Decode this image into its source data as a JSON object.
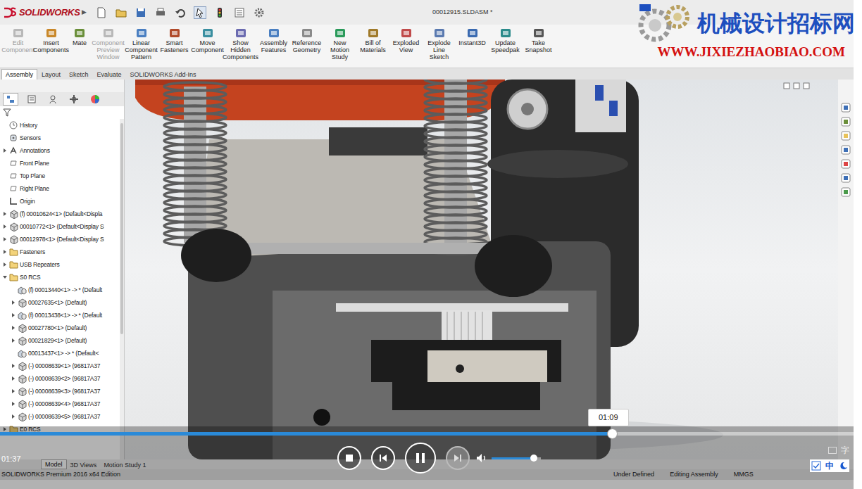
{
  "window": {
    "title": "00012915.SLDASM *",
    "brand": "SOLIDWORKS",
    "expand": "▶"
  },
  "watermark": {
    "name": "机械设计招标网",
    "url": "WWW.JIXIEZHAOBIAO.COM"
  },
  "ribbon": [
    {
      "label": "Edit Component",
      "disabled": true
    },
    {
      "label": "Insert Components",
      "disabled": false
    },
    {
      "label": "Mate",
      "disabled": false
    },
    {
      "label": "Component Preview Window",
      "disabled": true
    },
    {
      "label": "Linear Component Pattern",
      "disabled": false
    },
    {
      "label": "Smart Fasteners",
      "disabled": false
    },
    {
      "label": "Move Component",
      "disabled": false
    },
    {
      "label": "Show Hidden Components",
      "disabled": false
    },
    {
      "label": "Assembly Features",
      "disabled": false
    },
    {
      "label": "Reference Geometry",
      "disabled": false
    },
    {
      "label": "New Motion Study",
      "disabled": false
    },
    {
      "label": "Bill of Materials",
      "disabled": false
    },
    {
      "label": "Exploded View",
      "disabled": false
    },
    {
      "label": "Explode Line Sketch",
      "disabled": false
    },
    {
      "label": "Instant3D",
      "disabled": false
    },
    {
      "label": "Update Speedpak",
      "disabled": false
    },
    {
      "label": "Take Snapshot",
      "disabled": false
    }
  ],
  "tabs": [
    {
      "label": "Assembly",
      "selected": true
    },
    {
      "label": "Layout",
      "selected": false
    },
    {
      "label": "Sketch",
      "selected": false
    },
    {
      "label": "Evaluate",
      "selected": false
    },
    {
      "label": "SOLIDWORKS Add-Ins",
      "selected": false
    }
  ],
  "tree": [
    {
      "label": "History",
      "kind": "history",
      "level": 0,
      "has_children": false,
      "expanded": false
    },
    {
      "label": "Sensors",
      "kind": "sensors",
      "level": 0,
      "has_children": false,
      "expanded": false
    },
    {
      "label": "Annotations",
      "kind": "annotations",
      "level": 0,
      "has_children": true,
      "expanded": false
    },
    {
      "label": "Front Plane",
      "kind": "plane",
      "level": 0,
      "has_children": false,
      "expanded": false
    },
    {
      "label": "Top Plane",
      "kind": "plane",
      "level": 0,
      "has_children": false,
      "expanded": false
    },
    {
      "label": "Right Plane",
      "kind": "plane",
      "level": 0,
      "has_children": false,
      "expanded": false
    },
    {
      "label": "Origin",
      "kind": "origin",
      "level": 0,
      "has_children": false,
      "expanded": false
    },
    {
      "label": "(f) 00010624<1> (Default<Displa",
      "kind": "part",
      "level": 0,
      "has_children": true,
      "expanded": false
    },
    {
      "label": "00010772<1> (Default<Display S",
      "kind": "part",
      "level": 0,
      "has_children": true,
      "expanded": false
    },
    {
      "label": "00012978<1> (Default<Display S",
      "kind": "part",
      "level": 0,
      "has_children": true,
      "expanded": false
    },
    {
      "label": "Fasteners",
      "kind": "folder",
      "level": 0,
      "has_children": true,
      "expanded": false
    },
    {
      "label": "USB Repeaters",
      "kind": "folder",
      "level": 0,
      "has_children": true,
      "expanded": false
    },
    {
      "label": "S0 RCS",
      "kind": "folder",
      "level": 0,
      "has_children": true,
      "expanded": true
    },
    {
      "label": "(f) 00013440<1> -> * (Default",
      "kind": "assembly",
      "level": 1,
      "has_children": false,
      "expanded": false
    },
    {
      "label": "00027635<1> (Default)",
      "kind": "part",
      "level": 1,
      "has_children": true,
      "expanded": false
    },
    {
      "label": "(f) 00013438<1> -> * (Default",
      "kind": "assembly",
      "level": 1,
      "has_children": true,
      "expanded": false
    },
    {
      "label": "00027780<1> (Default)",
      "kind": "part",
      "level": 1,
      "has_children": true,
      "expanded": false
    },
    {
      "label": "00021829<1> (Default)",
      "kind": "part",
      "level": 1,
      "has_children": true,
      "expanded": false
    },
    {
      "label": "00013437<1> -> * (Default<",
      "kind": "assembly",
      "level": 1,
      "has_children": false,
      "expanded": false
    },
    {
      "label": "(-) 00008639<1> (96817A37",
      "kind": "part",
      "level": 1,
      "has_children": true,
      "expanded": false
    },
    {
      "label": "(-) 00008639<2> (96817A37",
      "kind": "part",
      "level": 1,
      "has_children": true,
      "expanded": false
    },
    {
      "label": "(-) 00008639<3> (96817A37",
      "kind": "part",
      "level": 1,
      "has_children": true,
      "expanded": false
    },
    {
      "label": "(-) 00008639<4> (96817A37",
      "kind": "part",
      "level": 1,
      "has_children": true,
      "expanded": false
    },
    {
      "label": "(-) 00008639<5> (96817A37",
      "kind": "part",
      "level": 1,
      "has_children": true,
      "expanded": false
    },
    {
      "label": "E0 RCS",
      "kind": "folder",
      "level": 0,
      "has_children": true,
      "expanded": false
    }
  ],
  "bottom_tabs": [
    {
      "label": "Model",
      "selected": true
    },
    {
      "label": "3D Views",
      "selected": false
    },
    {
      "label": "Motion Study 1",
      "selected": false
    }
  ],
  "status_bar": {
    "edition": "SOLIDWORKS Premium 2016 x64 Edition",
    "items": [
      "Under Defined",
      "Editing Assembly",
      "MMGS"
    ]
  },
  "player": {
    "elapsed": "01:37",
    "hover_time": "01:09",
    "progress": 0.717,
    "volume": 0.86,
    "playing": true,
    "next_disabled": true
  },
  "ime": {
    "char": "字",
    "mode": "中"
  }
}
